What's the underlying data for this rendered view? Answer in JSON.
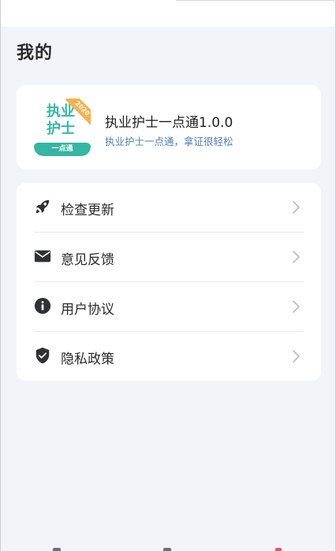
{
  "page": {
    "title": "我的"
  },
  "app": {
    "name": "执业护士一点通1.0.0",
    "slogan": "执业护士一点通，拿证很轻松",
    "logo": {
      "line1": "执业",
      "line2": "护士",
      "banner": "一点通",
      "ribbon": "2020"
    }
  },
  "menu": {
    "items": [
      {
        "label": "检查更新",
        "icon": "rocket-icon"
      },
      {
        "label": "意见反馈",
        "icon": "envelope-icon"
      },
      {
        "label": "用户协议",
        "icon": "info-icon"
      },
      {
        "label": "隐私政策",
        "icon": "shield-check-icon"
      }
    ]
  },
  "colors": {
    "background": "#f2f4f9",
    "card": "#ffffff",
    "slogan": "#4f7fb3",
    "brand_teal": "#34b6a3",
    "ribbon_orange": "#f6b24a"
  }
}
